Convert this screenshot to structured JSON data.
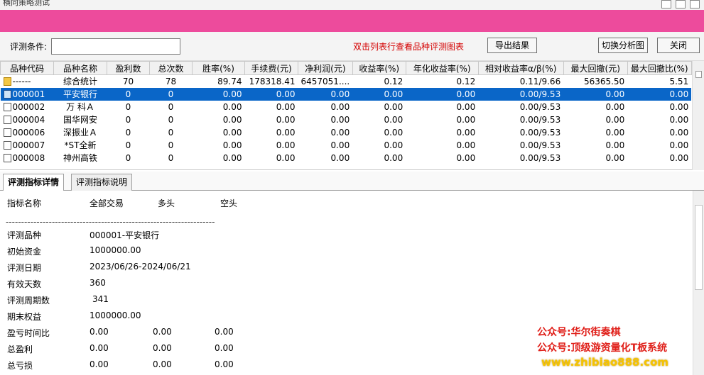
{
  "window": {
    "title": "横向策略测试"
  },
  "toolbar": {
    "condition_label": "评测条件:",
    "condition_value": "",
    "hint": "双击列表行查看品种评测图表",
    "export_label": "导出结果",
    "switch_label": "切换分析图",
    "close_label": "关闭"
  },
  "grid": {
    "columns": [
      "品种代码",
      "品种名称",
      "盈利数",
      "总次数",
      "胜率(%)",
      "手续费(元)",
      "净利润(元)",
      "收益率(%)",
      "年化收益率(%)",
      "相对收益率α/β(%)",
      "最大回撤(元)",
      "最大回撤比(%)"
    ],
    "rows": [
      {
        "icon": "folder-icon",
        "cells": [
          "------",
          "综合统计",
          "70",
          "78",
          "89.74",
          "178318.41",
          "6457051....",
          "0.12",
          "0.12",
          "0.11/9.66",
          "56365.50",
          "5.51"
        ]
      },
      {
        "icon": "document-icon",
        "selected": true,
        "cells": [
          "000001",
          "平安银行",
          "0",
          "0",
          "0.00",
          "0.00",
          "0.00",
          "0.00",
          "0.00",
          "0.00/9.53",
          "0.00",
          "0.00"
        ]
      },
      {
        "icon": "document-icon",
        "cells": [
          "000002",
          "万 科Ａ",
          "0",
          "0",
          "0.00",
          "0.00",
          "0.00",
          "0.00",
          "0.00",
          "0.00/9.53",
          "0.00",
          "0.00"
        ]
      },
      {
        "icon": "document-icon",
        "cells": [
          "000004",
          "国华网安",
          "0",
          "0",
          "0.00",
          "0.00",
          "0.00",
          "0.00",
          "0.00",
          "0.00/9.53",
          "0.00",
          "0.00"
        ]
      },
      {
        "icon": "document-icon",
        "cells": [
          "000006",
          "深振业Ａ",
          "0",
          "0",
          "0.00",
          "0.00",
          "0.00",
          "0.00",
          "0.00",
          "0.00/9.53",
          "0.00",
          "0.00"
        ]
      },
      {
        "icon": "document-icon",
        "cells": [
          "000007",
          "*ST全新",
          "0",
          "0",
          "0.00",
          "0.00",
          "0.00",
          "0.00",
          "0.00",
          "0.00/9.53",
          "0.00",
          "0.00"
        ]
      },
      {
        "icon": "document-icon",
        "cells": [
          "000008",
          "神州高铁",
          "0",
          "0",
          "0.00",
          "0.00",
          "0.00",
          "0.00",
          "0.00",
          "0.00/9.53",
          "0.00",
          "0.00"
        ]
      }
    ]
  },
  "tabs": [
    {
      "label": "评测指标详情",
      "active": true
    },
    {
      "label": "评测指标说明",
      "active": false
    }
  ],
  "detail": {
    "header": [
      "指标名称",
      "全部交易",
      "多头",
      "空头"
    ],
    "separator": "--------------------------------------------------------------------",
    "rows": [
      {
        "name": "评测品种",
        "values": [
          "000001-平安银行"
        ]
      },
      {
        "name": "初始资金",
        "values": [
          "1000000.00"
        ]
      },
      {
        "name": "评测日期",
        "values": [
          "2023/06/26-2024/06/21"
        ]
      },
      {
        "name": "有效天数",
        "values": [
          "360"
        ]
      },
      {
        "name": "评测周期数",
        "values": [
          "341"
        ]
      },
      {
        "name": "期末权益",
        "values": [
          "1000000.00"
        ]
      },
      {
        "name": "盈亏时间比",
        "values": [
          "0.00",
          "0.00",
          "0.00"
        ]
      },
      {
        "name": "总盈利",
        "values": [
          "0.00",
          "0.00",
          "0.00"
        ]
      },
      {
        "name": "总亏损",
        "values": [
          "0.00",
          "0.00",
          "0.00"
        ]
      }
    ]
  },
  "watermark": {
    "line1": "公众号:华尔街奏棋",
    "line2": "公众号:顶级游资量化T板系统",
    "line3": "www.zhibiao888.com"
  },
  "colors": {
    "accent_bar": "#ed4b9c",
    "selected_row": "#0a66c8",
    "hint_text": "#d40000",
    "watermark_red": "#e0201a",
    "watermark_yellow": "#f5c400"
  }
}
